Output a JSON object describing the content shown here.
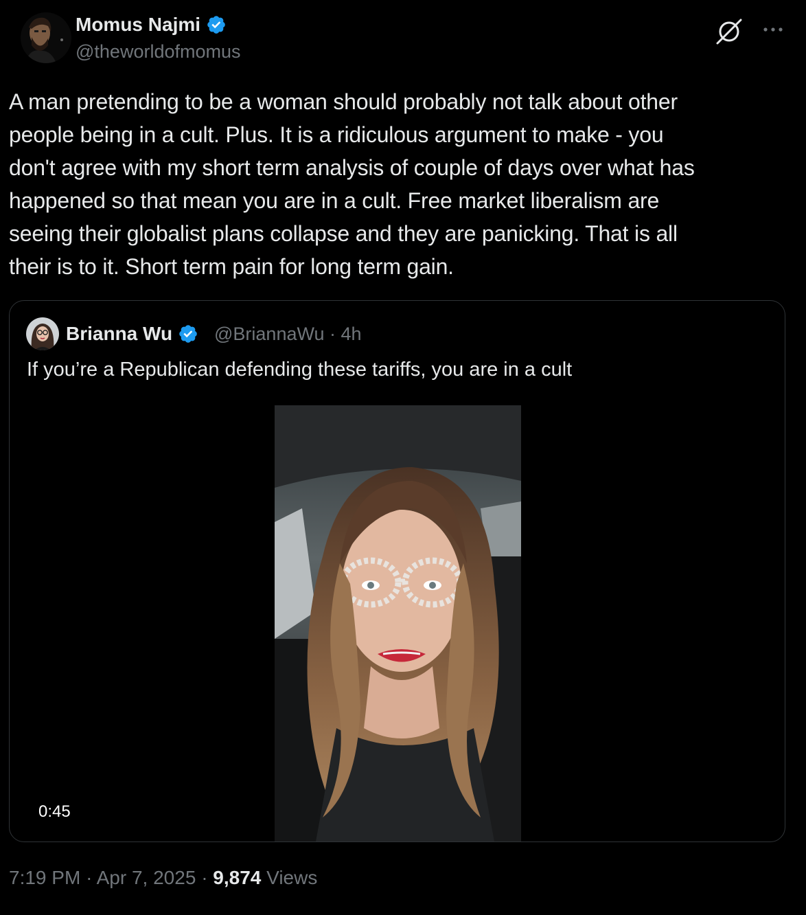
{
  "author": {
    "name": "Momus Najmi",
    "handle": "@theworldofmomus",
    "verified": true
  },
  "icons": {
    "grok": "grok-icon",
    "more": "more-icon",
    "verified": "verified-badge-icon"
  },
  "post": {
    "text_lines": [
      "A man pretending to be a woman should probably not talk about other",
      "people being in a cult. Plus. It is a ridiculous argument to make - you",
      "don't agree with my short term analysis of couple of days over what has",
      "happened so that mean you are in a cult. Free market liberalism are",
      "seeing their globalist plans collapse and they are panicking. That is all",
      "their is to it. Short term pain for long term gain."
    ]
  },
  "quoted": {
    "name": "Brianna Wu",
    "handle_time": "@BriannaWu · 4h",
    "verified": true,
    "text": "If you’re a Republican defending these tariffs, you are in a cult",
    "video": {
      "duration": "0:45"
    }
  },
  "footer": {
    "time": "7:19 PM",
    "separator": "·",
    "date": "Apr 7, 2025",
    "views_count": "9,874",
    "views_label": "Views"
  },
  "colors": {
    "background": "#000000",
    "text": "#e7e9ea",
    "secondary": "#71767b",
    "border": "#2f3336",
    "verified": "#1d9bf0"
  }
}
